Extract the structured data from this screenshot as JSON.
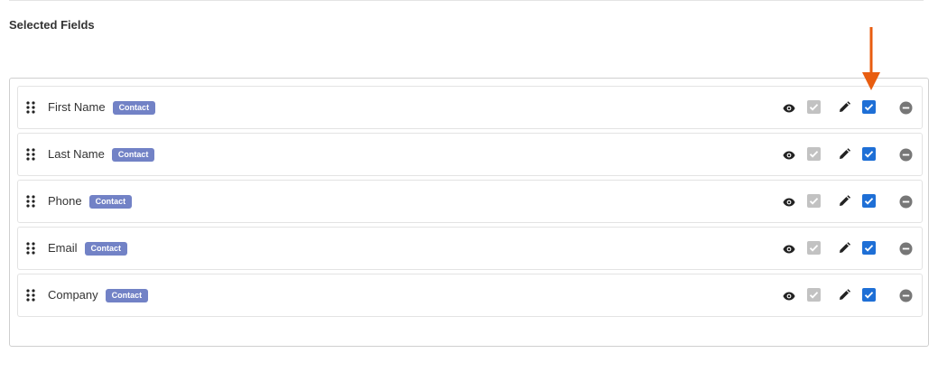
{
  "section": {
    "title": "Selected Fields"
  },
  "fields": [
    {
      "name": "First Name",
      "badge": "Contact"
    },
    {
      "name": "Last Name",
      "badge": "Contact"
    },
    {
      "name": "Phone",
      "badge": "Contact"
    },
    {
      "name": "Email",
      "badge": "Contact"
    },
    {
      "name": "Company",
      "badge": "Contact"
    }
  ],
  "row_icons": {
    "drag": "drag-handle-icon",
    "view": "eye-icon",
    "view_checkbox": "checkbox-checked-disabled",
    "edit": "pencil-icon",
    "edit_checkbox": "checkbox-checked",
    "remove": "minus-circle-icon"
  },
  "colors": {
    "badge": "#7282c6",
    "checkbox_checked": "#1e6fd6",
    "checkbox_disabled": "#c2c2c2",
    "remove_icon": "#777777",
    "annotation_arrow": "#e85d10"
  }
}
